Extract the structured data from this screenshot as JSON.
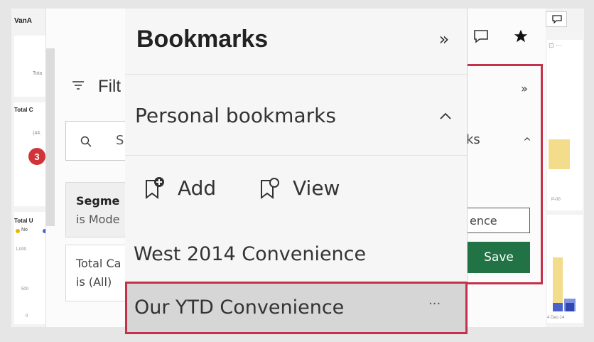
{
  "report": {
    "title_fragment": "VanA",
    "card_total_label": "Tota",
    "total_c_label": "Total C",
    "total_c_value": "(44.",
    "badge_count": "3",
    "total_u_label": "Total U",
    "legend_no": "No",
    "y_ticks": [
      "1,000",
      "500",
      "0"
    ],
    "axis_label_p": "P-00",
    "axis_label_dec": "4  Dec-14"
  },
  "filters": {
    "title_fragment": "Filt",
    "search_fragment": "S",
    "card1_title": "Segme",
    "card1_sub": "is Mode",
    "card2_title": "Total Ca",
    "card2_sub": "is (All)"
  },
  "bookmarks_back": {
    "section_fragment": "ks",
    "input_fragment": "ence",
    "save_label": "Save"
  },
  "bookmarks": {
    "title": "Bookmarks",
    "section_title": "Personal bookmarks",
    "add_label": "Add",
    "view_label": "View",
    "items": [
      {
        "label": "West 2014 Convenience"
      },
      {
        "label": "Our YTD Convenience",
        "more": "···"
      }
    ]
  },
  "colors": {
    "accent_red": "#c4314b",
    "save_green": "#217346",
    "badge_red": "#d13438",
    "chart_yellow": "#f4dc8d",
    "chart_blue": "#4a63c9"
  }
}
